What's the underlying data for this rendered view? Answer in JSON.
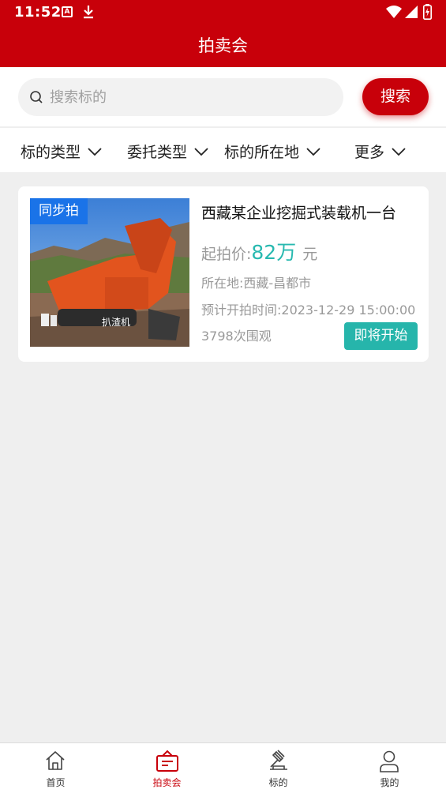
{
  "status_bar": {
    "time": "11:52",
    "a_badge": "A"
  },
  "header": {
    "title": "拍卖会"
  },
  "search": {
    "placeholder": "搜索标的",
    "value": "",
    "button_label": "搜索"
  },
  "filters": [
    {
      "label": "标的类型"
    },
    {
      "label": "委托类型"
    },
    {
      "label": "标的所在地"
    },
    {
      "label": "更多"
    }
  ],
  "listing": {
    "tag": "同步拍",
    "image_caption": "扒渣机",
    "title": "西藏某企业挖掘式装载机一台",
    "price_label": "起拍价:",
    "price_value": "82万",
    "price_unit": "元",
    "location": "所在地:西藏-昌都市",
    "start_time": "预计开拍时间:2023-12-29 15:00:00",
    "views": "3798次围观",
    "status": "即将开始"
  },
  "tabbar": {
    "items": [
      {
        "label": "首页",
        "icon": "home-icon"
      },
      {
        "label": "拍卖会",
        "icon": "auction-icon",
        "active": true
      },
      {
        "label": "标的",
        "icon": "gavel-icon"
      },
      {
        "label": "我的",
        "icon": "person-icon"
      }
    ]
  },
  "colors": {
    "brand_red": "#c8000a",
    "teal": "#28b9b0",
    "tag_blue": "#1a73e8"
  }
}
